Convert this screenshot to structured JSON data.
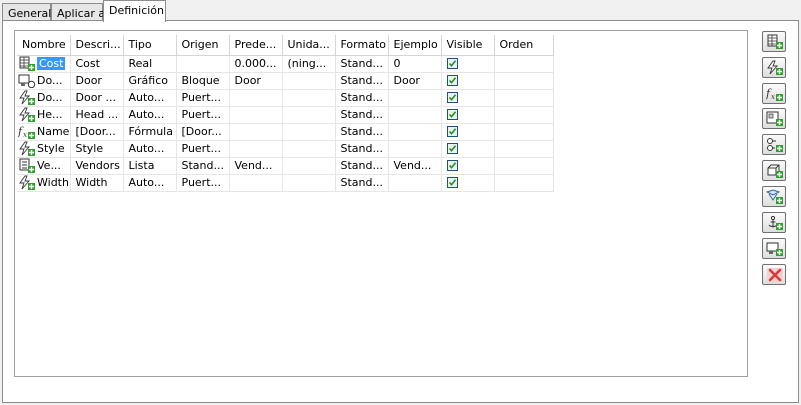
{
  "tabs": [
    {
      "label": "General",
      "active": false
    },
    {
      "label": "Aplicar a",
      "active": false
    },
    {
      "label": "Definición",
      "active": true
    }
  ],
  "columns": [
    "Nombre",
    "Descri...",
    "Tipo",
    "Origen",
    "Prede...",
    "Unida...",
    "Formato",
    "Ejemplo",
    "Visible",
    "Orden"
  ],
  "rows": [
    {
      "icon": "table-property-icon",
      "name": "Cost",
      "desc": "Cost",
      "type": "Real",
      "origin": "",
      "default": "0.000...",
      "unit": "(ning...",
      "format": "Stand...",
      "example": "0",
      "visible": true,
      "order": "",
      "selected": true
    },
    {
      "icon": "block-property-icon",
      "name": "Do...",
      "desc": "Door",
      "type": "Gráfico",
      "origin": "Bloque",
      "default": "Door",
      "unit": "",
      "format": "Stand...",
      "example": "Door",
      "visible": true,
      "order": "",
      "selected": false
    },
    {
      "icon": "auto-property-icon",
      "name": "Do...",
      "desc": "Door ...",
      "type": "Auto...",
      "origin": "Puert...",
      "default": "",
      "unit": "",
      "format": "Stand...",
      "example": "",
      "visible": true,
      "order": "",
      "selected": false
    },
    {
      "icon": "auto-property-icon",
      "name": "He...",
      "desc": "Head ...",
      "type": "Auto...",
      "origin": "Puert...",
      "default": "",
      "unit": "",
      "format": "Stand...",
      "example": "",
      "visible": true,
      "order": "",
      "selected": false
    },
    {
      "icon": "formula-property-icon",
      "name": "Name",
      "desc": "[Door...",
      "type": "Fórmula",
      "origin": "[Door...",
      "default": "",
      "unit": "",
      "format": "Stand...",
      "example": "",
      "visible": true,
      "order": "",
      "selected": false
    },
    {
      "icon": "auto-property-icon",
      "name": "Style",
      "desc": "Style",
      "type": "Auto...",
      "origin": "Puert...",
      "default": "",
      "unit": "",
      "format": "Stand...",
      "example": "",
      "visible": true,
      "order": "",
      "selected": false
    },
    {
      "icon": "list-property-icon",
      "name": "Ve...",
      "desc": "Vendors",
      "type": "Lista",
      "origin": "Stand...",
      "default": "Vend...",
      "unit": "",
      "format": "Stand...",
      "example": "Vend...",
      "visible": true,
      "order": "",
      "selected": false
    },
    {
      "icon": "auto-property-icon",
      "name": "Width",
      "desc": "Width",
      "type": "Auto...",
      "origin": "Puert...",
      "default": "",
      "unit": "",
      "format": "Stand...",
      "example": "",
      "visible": true,
      "order": "",
      "selected": false
    }
  ],
  "toolbar_buttons": [
    {
      "name": "add-manual-property-button",
      "icon": "table-add-icon"
    },
    {
      "name": "add-auto-property-button",
      "icon": "lightning-add-icon"
    },
    {
      "name": "add-formula-property-button",
      "icon": "formula-add-icon"
    },
    {
      "name": "add-location-property-button",
      "icon": "location-add-icon"
    },
    {
      "name": "add-classification-property-button",
      "icon": "classification-add-icon"
    },
    {
      "name": "add-material-property-button",
      "icon": "material-add-icon"
    },
    {
      "name": "add-graphic-property-button",
      "icon": "graphic-add-icon"
    },
    {
      "name": "add-anchor-property-button",
      "icon": "anchor-add-icon"
    },
    {
      "name": "add-block-property-button",
      "icon": "block-add-icon"
    },
    {
      "name": "delete-property-button",
      "icon": "delete-icon"
    }
  ],
  "colors": {
    "selection": "#3399ff",
    "add_badge": "#2ea12e",
    "delete": "#d93a3a",
    "check": "#2a8a2a"
  }
}
